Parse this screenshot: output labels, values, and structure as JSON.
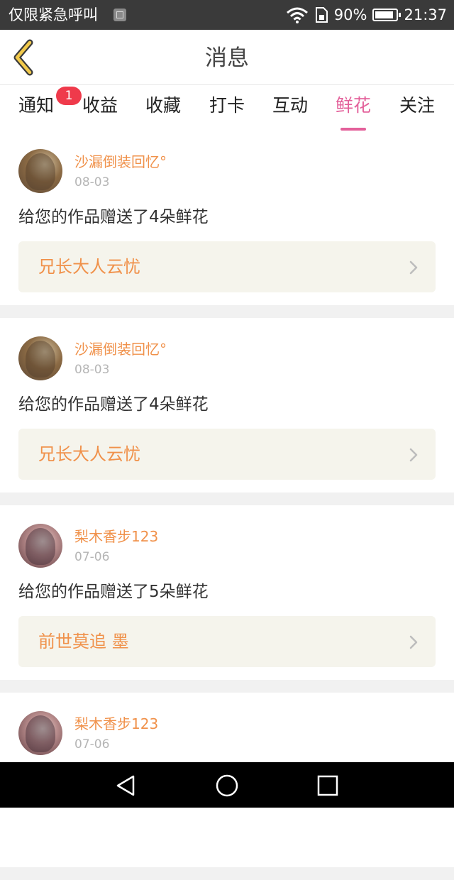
{
  "status_bar": {
    "carrier": "仅限紧急呼叫",
    "battery": "90%",
    "battery_level": 0.9,
    "time": "21:37"
  },
  "header": {
    "title": "消息"
  },
  "tabs": [
    {
      "label": "通知",
      "badge": "1"
    },
    {
      "label": "收益"
    },
    {
      "label": "收藏"
    },
    {
      "label": "打卡"
    },
    {
      "label": "互动"
    },
    {
      "label": "鲜花",
      "active": true
    },
    {
      "label": "关注"
    }
  ],
  "colors": {
    "accent": "#e3609a",
    "name": "#f0914a",
    "badge": "#ef3a4b"
  },
  "feed": [
    {
      "avatar": "avatar-photo",
      "name": "沙漏倒装回忆°",
      "date": "08-03",
      "message": "给您的作品赠送了4朵鲜花",
      "work": "兄长大人云忧"
    },
    {
      "avatar": "avatar-photo",
      "name": "沙漏倒装回忆°",
      "date": "08-03",
      "message": "给您的作品赠送了4朵鲜花",
      "work": "兄长大人云忧"
    },
    {
      "avatar": "avatar-anime",
      "name": "梨木香步123",
      "date": "07-06",
      "message": "给您的作品赠送了5朵鲜花",
      "work": "前世莫追 墨"
    },
    {
      "avatar": "avatar-anime",
      "name": "梨木香步123",
      "date": "07-06"
    }
  ]
}
